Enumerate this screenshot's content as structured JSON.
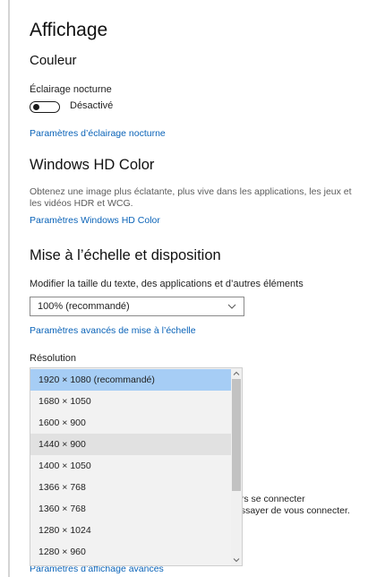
{
  "page": {
    "title": "Affichage"
  },
  "color_section": {
    "heading": "Couleur",
    "night_light_label": "Éclairage nocturne",
    "night_light_state": "Désactivé",
    "night_light_on": false,
    "night_light_link": "Paramètres d’éclairage nocturne"
  },
  "hdr_section": {
    "heading": "Windows HD Color",
    "description": "Obtenez une image plus éclatante, plus vive dans les applications, les jeux et les vidéos HDR et WCG.",
    "link": "Paramètres Windows HD Color"
  },
  "scale_section": {
    "heading": "Mise à l’échelle et disposition",
    "size_label": "Modifier la taille du texte, des applications et d’autres éléments",
    "size_value": "100% (recommandé)",
    "advanced_scale_link": "Paramètres avancés de mise à l’échelle",
    "resolution_label": "Résolution",
    "resolutions": [
      "1920 × 1080 (recommandé)",
      "1680 × 1050",
      "1600 × 900",
      "1440 × 900",
      "1400 × 1050",
      "1366 × 768",
      "1360 × 768",
      "1280 × 1024",
      "1280 × 960"
    ],
    "selected_resolution_index": 0,
    "hover_resolution_index": 3
  },
  "behind_text": {
    "line1": "urs se connecter",
    "line2": "essayer de vous connecter."
  },
  "footer_link": "Paramètres d’affichage avancés",
  "colors": {
    "link": "#0a63b8",
    "selected": "#a6cdf5",
    "hover": "#e1e1e1"
  }
}
